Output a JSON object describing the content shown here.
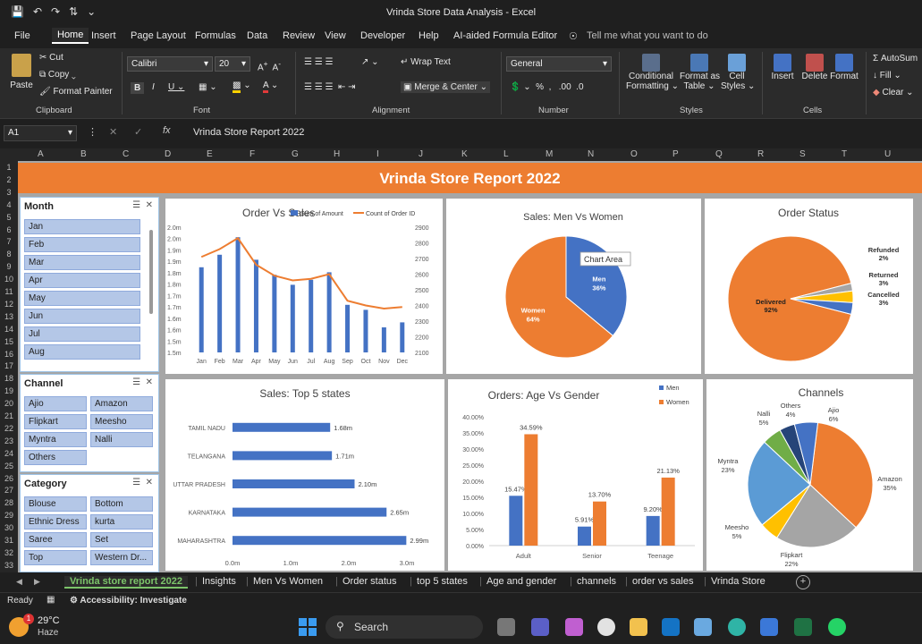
{
  "window": {
    "title": "Vrinda Store Data Analysis  -  Excel"
  },
  "menu": [
    "File",
    "Home",
    "Insert",
    "Page Layout",
    "Formulas",
    "Data",
    "Review",
    "View",
    "Developer",
    "Help",
    "AI-aided Formula Editor"
  ],
  "menu_active": "Home",
  "tell_me": "Tell me what you want to do",
  "ribbon": {
    "paste": "Paste",
    "cut": "Cut",
    "copy": "Copy",
    "format_painter": "Format Painter",
    "clipboard": "Clipboard",
    "font_name": "Calibri",
    "font_size": "20",
    "font": "Font",
    "wrap_text": "Wrap Text",
    "merge_center": "Merge & Center",
    "alignment": "Alignment",
    "number_format": "General",
    "number": "Number",
    "conditional_formatting_1": "Conditional",
    "conditional_formatting_2": "Formatting",
    "format_as_table_1": "Format as",
    "format_as_table_2": "Table",
    "cell_styles_1": "Cell",
    "cell_styles_2": "Styles",
    "styles": "Styles",
    "insert": "Insert",
    "delete": "Delete",
    "format": "Format",
    "cells": "Cells",
    "autosum": "AutoSum",
    "fill": "Fill",
    "clear": "Clear"
  },
  "formula_bar": {
    "name_box": "A1",
    "content": "Vrinda Store Report 2022"
  },
  "columns": [
    "A",
    "B",
    "C",
    "D",
    "E",
    "F",
    "G",
    "H",
    "I",
    "J",
    "K",
    "L",
    "M",
    "N",
    "O",
    "P",
    "Q",
    "R",
    "S",
    "T",
    "U"
  ],
  "banner": "Vrinda Store Report 2022",
  "slicers": {
    "month": {
      "header": "Month",
      "items": [
        "Jan",
        "Feb",
        "Mar",
        "Apr",
        "May",
        "Jun",
        "Jul",
        "Aug"
      ]
    },
    "channel": {
      "header": "Channel",
      "items": [
        "Ajio",
        "Amazon",
        "Flipkart",
        "Meesho",
        "Myntra",
        "Nalli",
        "Others"
      ]
    },
    "category": {
      "header": "Category",
      "items": [
        "Blouse",
        "Bottom",
        "Ethnic Dress",
        "kurta",
        "Saree",
        "Set",
        "Top",
        "Western Dr..."
      ]
    }
  },
  "chart_data": [
    {
      "type": "bar",
      "title": "Order Vs Sales",
      "categories": [
        "Jan",
        "Feb",
        "Mar",
        "Apr",
        "May",
        "Jun",
        "Jul",
        "Aug",
        "Sep",
        "Oct",
        "Nov",
        "Dec"
      ],
      "series": [
        {
          "name": "Sum of Amount",
          "type": "bar",
          "axis": "left",
          "values": [
            1.84,
            1.89,
            1.96,
            1.87,
            1.81,
            1.77,
            1.79,
            1.82,
            1.69,
            1.67,
            1.6,
            1.62
          ]
        },
        {
          "name": "Count of Order ID",
          "type": "line",
          "axis": "right",
          "values": [
            2710,
            2760,
            2830,
            2660,
            2590,
            2560,
            2570,
            2600,
            2430,
            2400,
            2380,
            2390
          ]
        }
      ],
      "yticks_left": [
        "1.5m",
        "1.5m",
        "1.6m",
        "1.6m",
        "1.7m",
        "1.7m",
        "1.8m",
        "1.8m",
        "1.9m",
        "1.9m",
        "2.0m",
        "2.0m"
      ],
      "yticks_right": [
        "2100",
        "2200",
        "2300",
        "2400",
        "2500",
        "2600",
        "2700",
        "2800",
        "2900"
      ],
      "ylim_left": [
        1.5,
        2.0
      ],
      "ylim_right": [
        2100,
        2900
      ],
      "legend": "top"
    },
    {
      "type": "pie",
      "title": "Sales: Men Vs Women",
      "labels": [
        "Men",
        "Women"
      ],
      "values": [
        36,
        64
      ],
      "value_labels": [
        "36%",
        "64%"
      ],
      "colors": [
        "#4472c4",
        "#ed7d31"
      ],
      "tooltip": "Chart Area"
    },
    {
      "type": "pie",
      "title": "Order Status",
      "labels": [
        "Delivered",
        "Refunded",
        "Returned",
        "Cancelled"
      ],
      "values": [
        92,
        2,
        3,
        3
      ],
      "value_labels": [
        "92%",
        "2%",
        "3%",
        "3%"
      ],
      "colors": [
        "#ed7d31",
        "#a5a5a5",
        "#ffc000",
        "#4472c4"
      ]
    },
    {
      "type": "bar",
      "orientation": "horizontal",
      "title": "Sales: Top 5 states",
      "categories": [
        "TAMIL NADU",
        "TELANGANA",
        "UTTAR PRADESH",
        "KARNATAKA",
        "MAHARASHTRA"
      ],
      "values": [
        1.68,
        1.71,
        2.1,
        2.65,
        2.99
      ],
      "value_labels": [
        "1.68m",
        "1.71m",
        "2.10m",
        "2.65m",
        "2.99m"
      ],
      "xticks": [
        "0.0m",
        "1.0m",
        "2.0m",
        "3.0m"
      ],
      "xlim": [
        0,
        3.0
      ]
    },
    {
      "type": "bar",
      "title": "Orders: Age Vs Gender",
      "categories": [
        "Adult",
        "Senior",
        "Teenage"
      ],
      "series": [
        {
          "name": "Men",
          "values": [
            15.47,
            5.91,
            9.2
          ],
          "value_labels": [
            "15.47%",
            "5.91%",
            "9.20%"
          ]
        },
        {
          "name": "Women",
          "values": [
            34.59,
            13.7,
            21.13
          ],
          "value_labels": [
            "34.59%",
            "13.70%",
            "21.13%"
          ]
        }
      ],
      "yticks": [
        "0.00%",
        "5.00%",
        "10.00%",
        "15.00%",
        "20.00%",
        "25.00%",
        "30.00%",
        "35.00%",
        "40.00%"
      ],
      "ylim": [
        0,
        40
      ],
      "legend": "top-right"
    },
    {
      "type": "pie",
      "title": "Channels",
      "labels": [
        "Amazon",
        "Flipkart",
        "Meesho",
        "Myntra",
        "Nalli",
        "Others",
        "Ajio"
      ],
      "values": [
        35,
        22,
        5,
        23,
        5,
        4,
        6
      ],
      "value_labels": [
        "35%",
        "22%",
        "5%",
        "23%",
        "5%",
        "4%",
        "6%"
      ],
      "colors": [
        "#ed7d31",
        "#a5a5a5",
        "#ffc000",
        "#5b9bd5",
        "#70ad47",
        "#264478",
        "#4472c4"
      ]
    }
  ],
  "sheet_tabs": [
    "Vrinda store report 2022",
    "Insights",
    "Men Vs Women",
    "Order status",
    "top 5 states",
    "Age and gender",
    "channels",
    "order vs sales",
    "Vrinda Store"
  ],
  "active_tab": "Vrinda store report 2022",
  "status": {
    "ready": "Ready",
    "accessibility": "Accessibility: Investigate"
  },
  "taskbar": {
    "temp": "29°C",
    "weather": "Haze",
    "search": "Search",
    "badge": "1"
  }
}
